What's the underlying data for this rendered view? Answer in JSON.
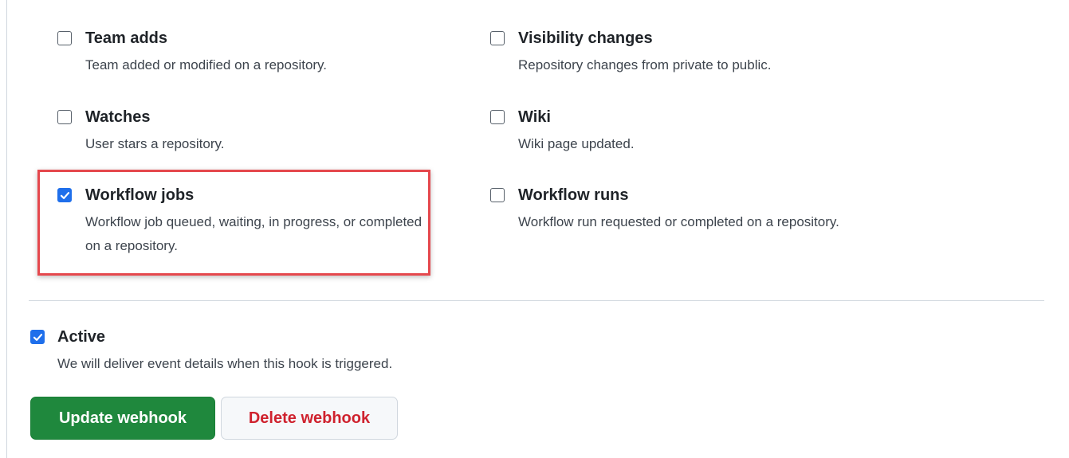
{
  "events": [
    {
      "id": "team-adds",
      "title": "Team adds",
      "description": "Team added or modified on a repository.",
      "checked": false
    },
    {
      "id": "visibility",
      "title": "Visibility changes",
      "description": "Repository changes from private to public.",
      "checked": false
    },
    {
      "id": "watches",
      "title": "Watches",
      "description": "User stars a repository.",
      "checked": false
    },
    {
      "id": "wiki",
      "title": "Wiki",
      "description": "Wiki page updated.",
      "checked": false
    },
    {
      "id": "wf-jobs",
      "title": "Workflow jobs",
      "description": "Workflow job queued, waiting, in progress, or completed on a repository.",
      "checked": true
    },
    {
      "id": "wf-runs",
      "title": "Workflow runs",
      "description": "Workflow run requested or completed on a repository.",
      "checked": false
    }
  ],
  "active": {
    "title": "Active",
    "description": "We will deliver event details when this hook is triggered.",
    "checked": true
  },
  "buttons": {
    "update_label": "Update webhook",
    "delete_label": "Delete webhook"
  },
  "colors": {
    "checkbox_checked": "#1f6feb",
    "primary_button": "#1f883d",
    "danger_text": "#cf222e",
    "highlight": "#e5484d"
  }
}
